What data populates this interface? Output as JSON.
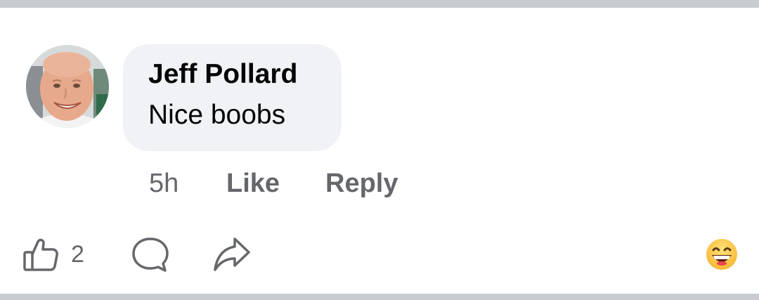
{
  "comment": {
    "author": "Jeff Pollard",
    "text": "Nice boobs",
    "time": "5h",
    "like_label": "Like",
    "reply_label": "Reply"
  },
  "actions": {
    "like_count": "2"
  },
  "icons": {
    "like": "thumbs-up-icon",
    "comment": "comment-bubble-icon",
    "share": "share-arrow-icon",
    "emoji": "grinning-face-emoji-icon"
  },
  "colors": {
    "bubble": "#f0f2f5",
    "meta_text": "#65676b",
    "primary_text": "#050505",
    "divider": "#c8ccd1"
  }
}
